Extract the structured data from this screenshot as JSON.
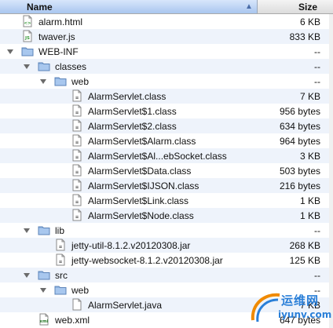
{
  "header": {
    "name_label": "Name",
    "size_label": "Size"
  },
  "rows": [
    {
      "label": "alarm.html",
      "size": "6 KB",
      "depth": 0,
      "kind": "html",
      "disclosure": "none"
    },
    {
      "label": "twaver.js",
      "size": "833 KB",
      "depth": 0,
      "kind": "js",
      "disclosure": "none"
    },
    {
      "label": "WEB-INF",
      "size": "--",
      "depth": 0,
      "kind": "folder",
      "disclosure": "open"
    },
    {
      "label": "classes",
      "size": "--",
      "depth": 1,
      "kind": "folder",
      "disclosure": "open"
    },
    {
      "label": "web",
      "size": "--",
      "depth": 2,
      "kind": "folder",
      "disclosure": "open"
    },
    {
      "label": "AlarmServlet.class",
      "size": "7 KB",
      "depth": 3,
      "kind": "class",
      "disclosure": "none"
    },
    {
      "label": "AlarmServlet$1.class",
      "size": "956 bytes",
      "depth": 3,
      "kind": "class",
      "disclosure": "none"
    },
    {
      "label": "AlarmServlet$2.class",
      "size": "634 bytes",
      "depth": 3,
      "kind": "class",
      "disclosure": "none"
    },
    {
      "label": "AlarmServlet$Alarm.class",
      "size": "964 bytes",
      "depth": 3,
      "kind": "class",
      "disclosure": "none"
    },
    {
      "label": "AlarmServlet$Al...ebSocket.class",
      "size": "3 KB",
      "depth": 3,
      "kind": "class",
      "disclosure": "none"
    },
    {
      "label": "AlarmServlet$Data.class",
      "size": "503 bytes",
      "depth": 3,
      "kind": "class",
      "disclosure": "none"
    },
    {
      "label": "AlarmServlet$IJSON.class",
      "size": "216 bytes",
      "depth": 3,
      "kind": "class",
      "disclosure": "none"
    },
    {
      "label": "AlarmServlet$Link.class",
      "size": "1 KB",
      "depth": 3,
      "kind": "class",
      "disclosure": "none"
    },
    {
      "label": "AlarmServlet$Node.class",
      "size": "1 KB",
      "depth": 3,
      "kind": "class",
      "disclosure": "none"
    },
    {
      "label": "lib",
      "size": "--",
      "depth": 1,
      "kind": "folder",
      "disclosure": "open"
    },
    {
      "label": "jetty-util-8.1.2.v20120308.jar",
      "size": "268 KB",
      "depth": 2,
      "kind": "jar",
      "disclosure": "none"
    },
    {
      "label": "jetty-websocket-8.1.2.v20120308.jar",
      "size": "125 KB",
      "depth": 2,
      "kind": "jar",
      "disclosure": "none"
    },
    {
      "label": "src",
      "size": "--",
      "depth": 1,
      "kind": "folder",
      "disclosure": "open"
    },
    {
      "label": "web",
      "size": "--",
      "depth": 2,
      "kind": "folder",
      "disclosure": "open"
    },
    {
      "label": "AlarmServlet.java",
      "size": "7 KB",
      "depth": 3,
      "kind": "java",
      "disclosure": "none"
    },
    {
      "label": "web.xml",
      "size": "647 bytes",
      "depth": 1,
      "kind": "xml",
      "disclosure": "none"
    }
  ],
  "watermark": {
    "line1": "运维网",
    "line2": "iyunv.com"
  }
}
